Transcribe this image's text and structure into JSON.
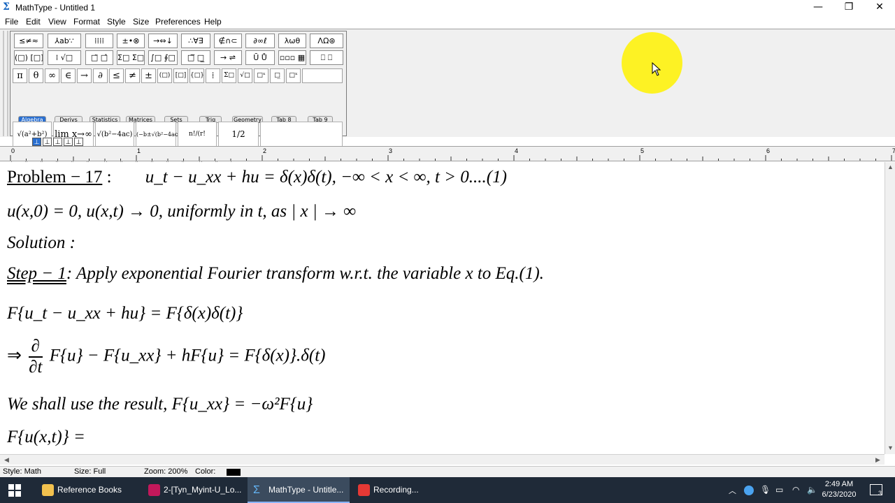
{
  "window": {
    "title": "MathType - Untitled 1",
    "app_icon": "Σ",
    "minimize": "—",
    "restore": "❐",
    "close": "✕"
  },
  "menu": [
    "File",
    "Edit",
    "View",
    "Format",
    "Style",
    "Size",
    "Preferences",
    "Help"
  ],
  "palette": {
    "row1": [
      "≤≠≈",
      "⅄ab∵",
      "⁞⁞⁞⁞",
      "±•⊗",
      "→⇔↓",
      "∴∀∃",
      "∉∩⊂",
      "∂∞ℓ",
      "λωθ",
      "ΛΩ⊛"
    ],
    "row2": [
      "(□) [□]",
      "⁞ √□",
      "□̈ □̂",
      "Σ□ Σ□",
      "∫□ ∮□",
      "□̅ □̲",
      "→ ⇌",
      "Ū Ů",
      "▫▫▫ ▦",
      "⎕ ⎕"
    ],
    "row3": [
      "π",
      "θ",
      "∞",
      "∈",
      "→",
      "∂",
      "≤",
      "≠",
      "±",
      "(□)",
      "[□]",
      "{□}",
      "⁞",
      "Σ□",
      "√□",
      "□ˣ",
      "□̲",
      "□ˣ"
    ],
    "tabs": [
      "Algebra",
      "Derivs",
      "Statistics",
      "Matrices",
      "Sets",
      "Trig",
      "Geometry",
      "Tab 8",
      "Tab 9"
    ],
    "active_tab": "Algebra",
    "templates": [
      "√(a²+b²)",
      "lim x→∞",
      "√(b²−4ac)",
      "(−b±√(b²−4ac))/2a",
      "n!/(r!(n−r)!)",
      "1/2"
    ],
    "row5": [
      "ℤ",
      "𝕜",
      "F",
      "ℭ",
      "𝔄",
      "𝔐",
      "⊸",
      "⊗",
      "⊕",
      "◁",
      "▷",
      "[0,1]",
      "∞",
      "√"
    ]
  },
  "ruler": {
    "labels": [
      "0",
      "1",
      "2",
      "3",
      "4",
      "5",
      "6",
      "7"
    ]
  },
  "document": {
    "line1": {
      "problem_label": "Problem − 17",
      "colon": ":",
      "equation": "u_t − u_xx + hu = δ(x)δ(t), −∞ < x < ∞, t > 0....(1)"
    },
    "line2": "u(x,0) = 0, u(x,t) → 0, uniformly in t, as | x | → ∞",
    "line3": "Solution :",
    "line4": {
      "step_label": "Step − 1",
      "text": ": Apply exponential Fourier transform w.r.t. the variable x  to Eq.(1)."
    },
    "line5": "F{u_t − u_xx + hu} = F{δ(x)δ(t)}",
    "line6": {
      "arrow": "⇒",
      "num": "∂",
      "den": "∂t",
      "rest": "F{u} − F{u_xx} + hF{u} = F{δ(x)}.δ(t)"
    },
    "line7": "We shall use the result, F{u_xx} = −ω²F{u}",
    "line8": "F{u(x,t)} ="
  },
  "status": {
    "style": "Style: Math",
    "size": "Size: Full",
    "zoom": "Zoom: 200%",
    "color": "Color:",
    "color_value": "#000000"
  },
  "taskbar": {
    "items": [
      "Reference Books",
      "2-[Tyn_Myint-U_Lo...",
      "MathType - Untitle...",
      "Recording..."
    ],
    "active": "MathType - Untitle...",
    "time": "2:49 AM",
    "date": "6/23/2020",
    "notifications": "3"
  }
}
